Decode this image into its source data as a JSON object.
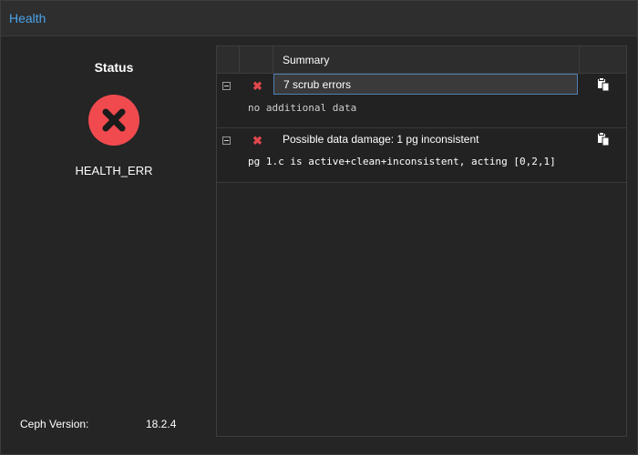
{
  "panel": {
    "title": "Health"
  },
  "status": {
    "heading": "Status",
    "icon": "error-x-circle-icon",
    "icon_color": "#ef4444",
    "state": "HEALTH_ERR"
  },
  "version": {
    "label": "Ceph Version:",
    "value": "18.2.4"
  },
  "grid": {
    "columns": [
      "",
      "",
      "Summary",
      ""
    ],
    "rows": [
      {
        "severity_icon": "error-x-icon",
        "summary": "7 scrub errors",
        "detail": "no additional data",
        "selected": true
      },
      {
        "severity_icon": "error-x-icon",
        "summary": "Possible data damage: 1 pg inconsistent",
        "detail": "pg 1.c is active+clean+inconsistent, acting [0,2,1]",
        "selected": false
      }
    ]
  },
  "colors": {
    "accent": "#4aa3e8",
    "error": "#e0474c"
  }
}
